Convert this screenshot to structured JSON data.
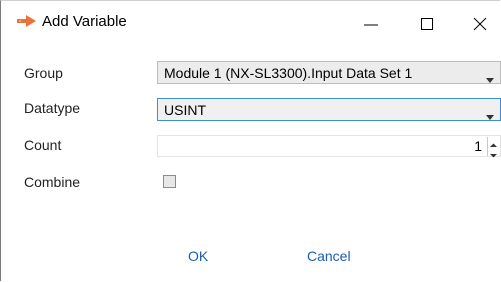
{
  "window": {
    "title": "Add Variable",
    "icons": {
      "app": "arrow-right-icon",
      "minimize": "minimize-icon",
      "maximize": "maximize-icon",
      "close": "close-icon"
    }
  },
  "form": {
    "group_label": "Group",
    "group_value": "Module 1 (NX-SL3300).Input Data Set 1",
    "datatype_label": "Datatype",
    "datatype_value": "USINT",
    "count_label": "Count",
    "count_value": "1",
    "combine_label": "Combine",
    "combine_checked": false
  },
  "buttons": {
    "ok": "OK",
    "cancel": "Cancel"
  },
  "colors": {
    "accent_icon": "#e8743b",
    "focus_border": "#3c8fd6",
    "button_text": "#1a5fb4"
  }
}
